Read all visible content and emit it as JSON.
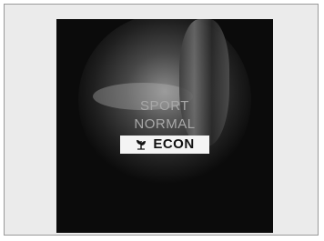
{
  "drive_modes": {
    "items": [
      {
        "label": "SPORT",
        "selected": false
      },
      {
        "label": "NORMAL",
        "selected": false
      },
      {
        "label": "ECON",
        "selected": true,
        "icon": "econ-leaf-icon"
      }
    ]
  },
  "colors": {
    "screen_background": "#0b0b0b",
    "unselected_text": "#a8a8a8",
    "selected_background": "#f4f4f4",
    "selected_text": "#111111"
  }
}
